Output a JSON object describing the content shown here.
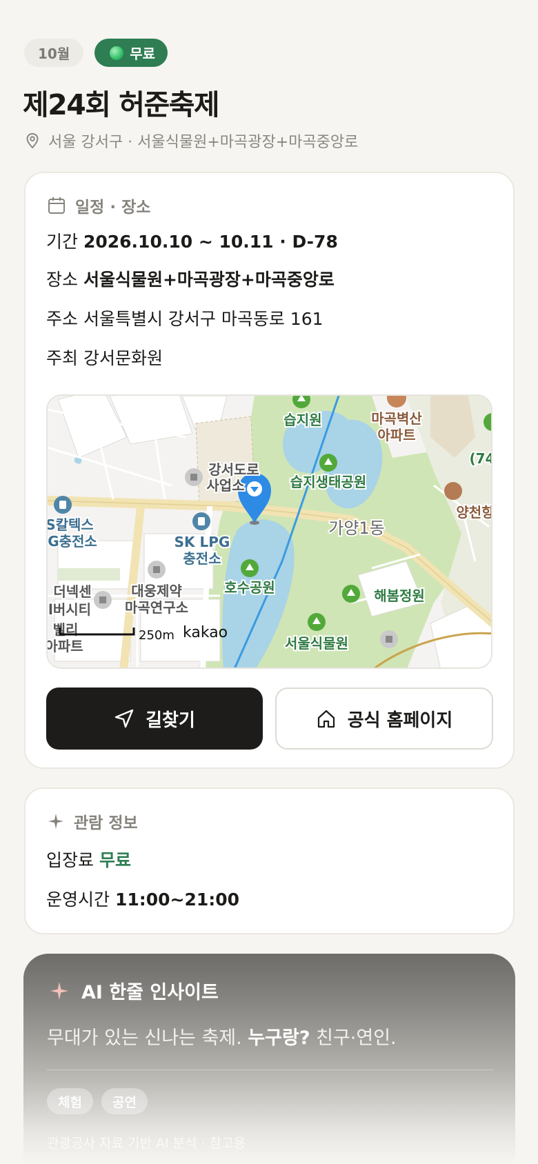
{
  "header": {
    "month_badge": "10월",
    "free_badge": "무료",
    "title": "제24회 허준축제",
    "location": "서울 강서구 · 서울식물원+마곡광장+마곡중앙로"
  },
  "schedule": {
    "section_title": "일정 · 장소",
    "period_label": "기간",
    "period_value": "2026.10.10 ~ 10.11 · D-78",
    "venue_label": "장소",
    "venue_value": "서울식물원+마곡광장+마곡중앙로",
    "address_label": "주소",
    "address_value": "서울특별시 강서구 마곡동로 161",
    "host_label": "주최",
    "host_value": "강서문화원"
  },
  "map": {
    "labels": {
      "wetland": "습지원",
      "apt1": "마곡벽산",
      "apt2": "아파트",
      "road1": "강서도로",
      "road2": "사업소",
      "eco_park": "습지생태공원",
      "lpg_left1": "S칼텍스",
      "lpg_left2": "G충전소",
      "sk1": "SK LPG",
      "sk2": "충전소",
      "dong": "가양1동",
      "yangcheon": "양천향",
      "bldg74": "(74",
      "lake_park": "호수공원",
      "haebom": "해봄정원",
      "the_nexen1": "더넥센",
      "the_nexen2": "l버시티",
      "daewoong1": "대웅제약",
      "daewoong2": "마곡연구소",
      "valley1": "벨리",
      "valley2": "아파트",
      "botanic": "서울식물원",
      "scale": "250m",
      "brand": "kakao"
    }
  },
  "actions": {
    "directions": "길찾기",
    "homepage": "공식 홈페이지"
  },
  "visit": {
    "section_title": "관람 정보",
    "fee_label": "입장료",
    "fee_value": "무료",
    "hours_label": "운영시간",
    "hours_value": "11:00~21:00"
  },
  "ai": {
    "title": "AI 한줄 인사이트",
    "text_a": "무대가 있는 신나는 축제.",
    "text_b": "누구랑?",
    "text_c": "친구·연인.",
    "tags": [
      "체험",
      "공연"
    ],
    "footnote": "관광공사 자료 기반 AI 분석 · 참고용"
  },
  "colors": {
    "accent_green": "#2e7d53",
    "dark_button": "#1d1c1a",
    "map_pin": "#2d8be6",
    "park_green": "#cfe5b5",
    "water": "#a9d3e6"
  }
}
